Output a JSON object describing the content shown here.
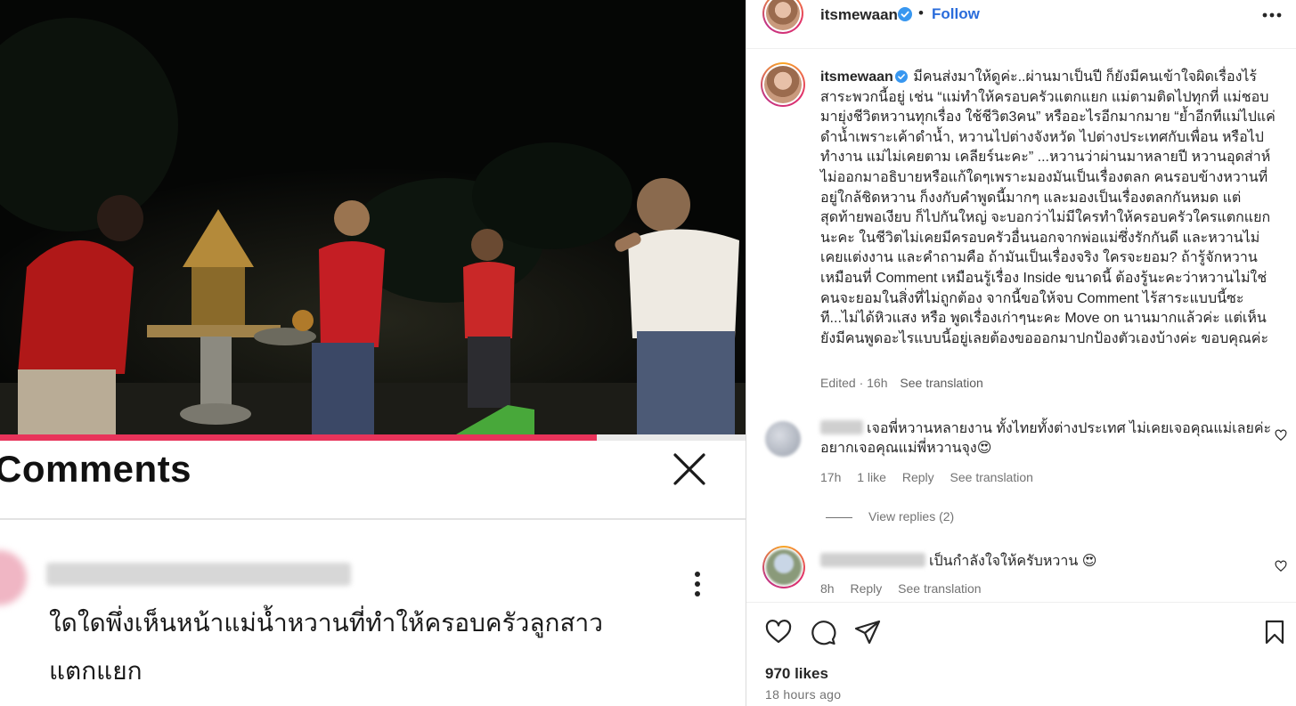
{
  "media": {
    "progress_fraction": 0.8,
    "comments_screenshot": {
      "title": "Comments",
      "comment_text": "ใดใดพึ่งเห็นหน้าแม่น้ำหวานที่ทำให้ครอบครัวลูกสาว แตกแยก"
    }
  },
  "post_header": {
    "username": "itsmewaan",
    "separator": "•",
    "follow_label": "Follow"
  },
  "caption": {
    "username": "itsmewaan",
    "text": "มีคนส่งมาให้ดูค่ะ..ผ่านมาเป็นปี ก็ยังมีคนเข้าใจผิดเรื่องไร้สาระพวกนี้อยู่ เช่น “แม่ทำให้ครอบครัวแตกแยก แม่ตามติดไปทุกที่ แม่ชอบมายุ่งชีวิตหวานทุกเรื่อง ใช้ชีวิต3คน” หรืออะไรอีกมากมาย “ย้ำอีกทีแม่ไปแค่ดำน้ำเพราะเค้าดำน้ำ, หวานไปต่างจังหวัด ไปต่างประเทศกับเพื่อน หรือไปทำงาน แม่ไม่เคยตาม เคลียร์นะคะ” ...หวานว่าผ่านมาหลายปี หวานอุดส่าห์ไม่ออกมาอธิบายหรือแก้ใดๆเพราะมองมันเป็นเรื่องตลก คนรอบข้างหวานที่อยู่ใกล้ชิดหวาน ก็งงกับคำพูดนี้มากๆ และมองเป็นเรื่องตลกกันหมด แต่สุดท้ายพอเงียบ ก็ไปกันใหญ่ จะบอกว่าไม่มีใครทำให้ครอบครัวใครแตกแยกนะคะ ในชีวิตไม่เคยมีครอบครัวอื่นนอกจากพ่อแม่ซึ่งรักกันดี และหวานไม่เคยแต่งงาน และคำถามคือ ถ้ามันเป็นเรื่องจริง ใครจะยอม? ถ้ารู้จักหวานเหมือนที่ Comment เหมือนรู้เรื่อง Inside ขนาดนี้ ต้องรู้นะคะว่าหวานไม่ใช่คนจะยอมในสิ่งที่ไม่ถูกต้อง จากนี้ขอให้จบ Comment ไร้สาระแบบนี้ซะที...ไม่ได้หิวแสง หรือ พูดเรื่องเก่าๆนะคะ Move on นานมากแล้วค่ะ แต่เห็นยังมีคนพูดอะไรแบบนี้อยู่เลยต้องขอออกมาปกป้องตัวเองบ้างค่ะ ขอบคุณค่ะ",
    "edited": "Edited · 16h",
    "see_translation": "See translation"
  },
  "comments": [
    {
      "text": "เจอพี่หวานหลายงาน ทั้งไทยทั้งต่างประเทศ ไม่เคยเจอคุณแม่เลยค่ะ อยากเจอคุณแม่พี่หวานจุง😍",
      "time": "17h",
      "likes": "1 like",
      "reply": "Reply",
      "translate": "See translation",
      "view_replies": "View replies (2)"
    },
    {
      "text": "เป็นกำลังใจให้ครับหวาน 😍",
      "time": "8h",
      "reply": "Reply",
      "translate": "See translation"
    }
  ],
  "footer": {
    "likes": "970 likes",
    "time_ago": "18 hours ago"
  },
  "icons": {
    "verified": "verified-badge-icon",
    "more": "more-horizontal-icon",
    "like": "heart-icon",
    "comment": "comment-bubble-icon",
    "share": "paper-plane-icon",
    "save": "bookmark-icon"
  },
  "colors": {
    "follow_blue": "#2a6cdb",
    "verified_blue": "#3897f0",
    "progress_pink": "#e8335a"
  }
}
